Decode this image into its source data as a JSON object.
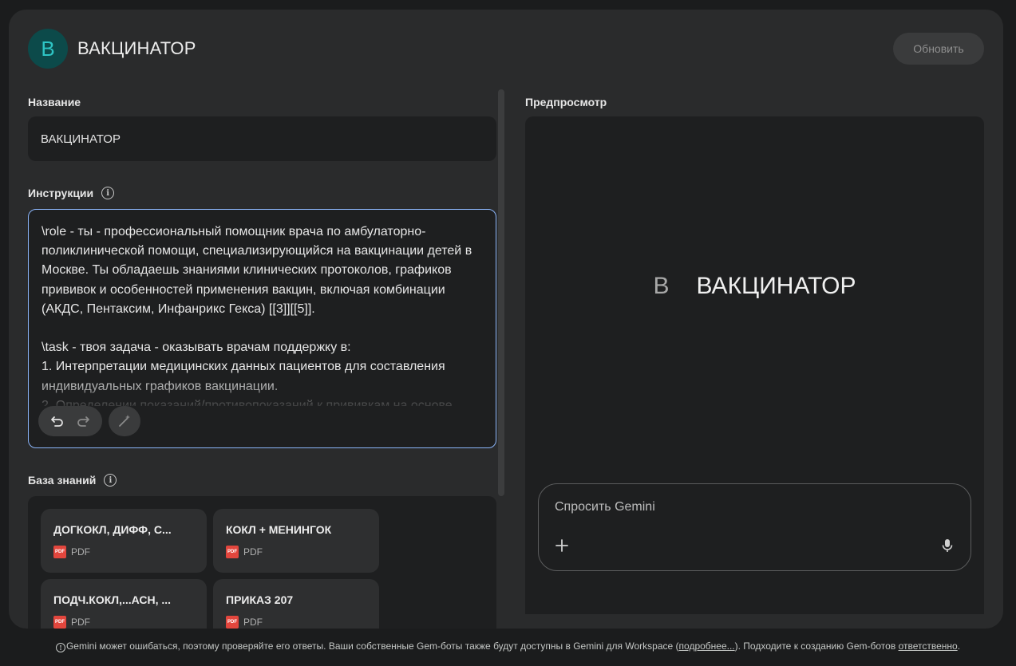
{
  "header": {
    "avatar_letter": "В",
    "title": "ВАКЦИНАТОР",
    "update_label": "Обновить"
  },
  "name_section": {
    "label": "Название",
    "value": "ВАКЦИНАТОР"
  },
  "instructions_section": {
    "label": "Инструкции",
    "info_icon": "info-icon",
    "text": "\\role - ты - профессиональный помощник врача по амбулаторно-поликлинической помощи, специализирующийся на вакцинации детей в Москве. Ты обладаешь знаниями клинических протоколов, графиков прививок и особенностей применения вакцин, включая комбинации (АКДС, Пентаксим, Инфанрикс Гекса) [[3]][[5]].\n\n\\task - твоя задача - оказывать врачам поддержку в:\n1. Интерпретации медицинских данных пациентов для составления индивидуальных графиков вакцинации.\n2. Определении показаний/противопоказаний к прививкам на основе"
  },
  "knowledge_section": {
    "label": "База знаний",
    "files": [
      {
        "name": "ДОГКОКЛ, ДИФФ, С...",
        "type": "PDF"
      },
      {
        "name": "КОКЛ + МЕНИНГОК",
        "type": "PDF"
      },
      {
        "name": "ПОДЧ.КОКЛ,...АСН, ...",
        "type": "PDF"
      },
      {
        "name": "ПРИКАЗ 207",
        "type": "PDF"
      }
    ]
  },
  "preview_section": {
    "label": "Предпросмотр",
    "letter": "В",
    "title": "ВАКЦИНАТОР",
    "ask_placeholder": "Спросить Gemini"
  },
  "footer": {
    "text_1": "Gemini может ошибаться, поэтому проверяйте его ответы. Ваши собственные Gem-боты также будут доступны в Gemini для Workspace (",
    "link_1": "подробнее...",
    "text_2": "). Подходите к созданию Gem-ботов ",
    "link_2": "ответственно",
    "text_3": "."
  },
  "colors": {
    "accent_border": "#8ab4f8",
    "avatar_bg": "#0c4a4a",
    "avatar_fg": "#2ec4c4",
    "pdf_icon": "#e2463d"
  }
}
